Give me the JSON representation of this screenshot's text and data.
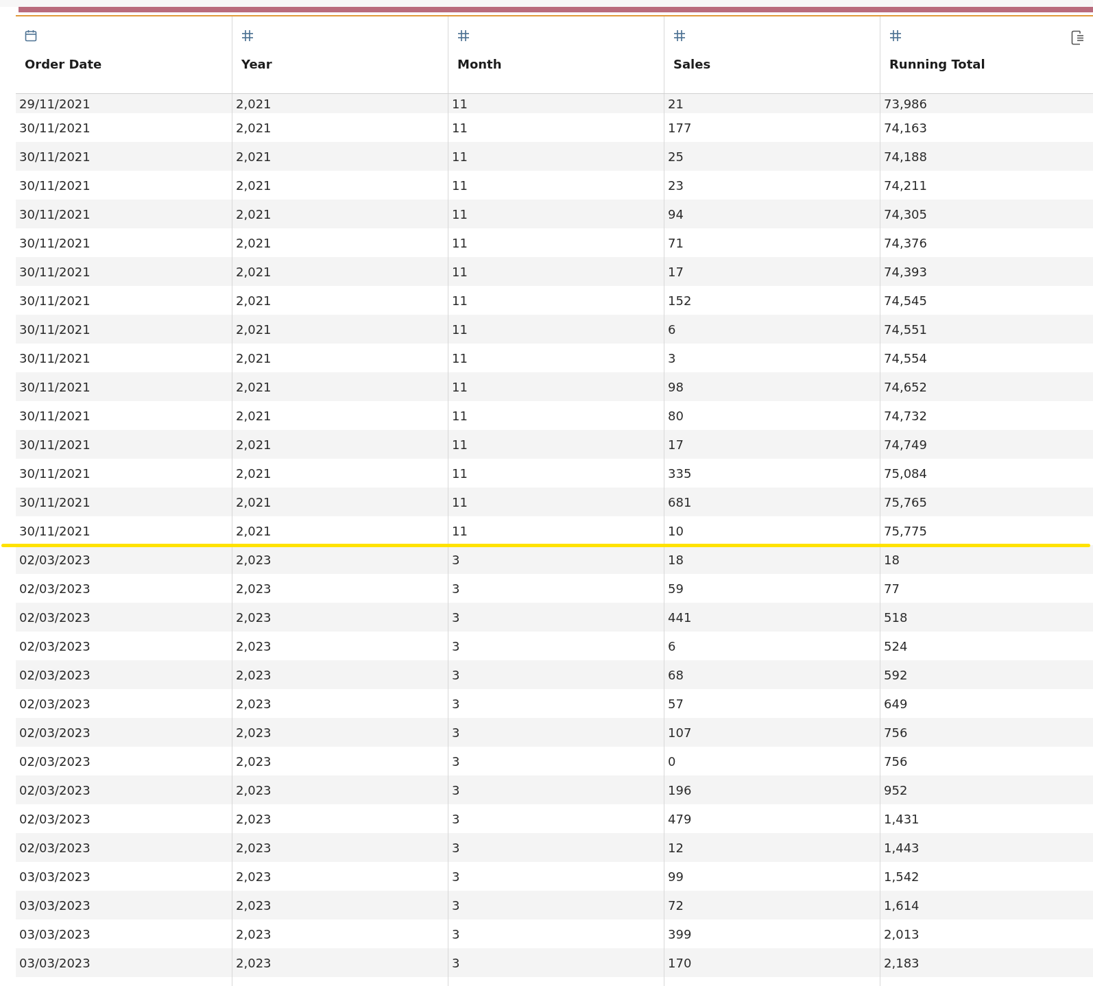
{
  "columns": [
    {
      "label": "Order Date",
      "kind": "date"
    },
    {
      "label": "Year",
      "kind": "number"
    },
    {
      "label": "Month",
      "kind": "number"
    },
    {
      "label": "Sales",
      "kind": "number"
    },
    {
      "label": "Running Total",
      "kind": "number"
    }
  ],
  "rows": [
    {
      "cells": [
        "29/11/2021",
        "2,021",
        "11",
        "21",
        "73,986"
      ],
      "marker_line_below": false
    },
    {
      "cells": [
        "30/11/2021",
        "2,021",
        "11",
        "177",
        "74,163"
      ],
      "marker_line_below": false
    },
    {
      "cells": [
        "30/11/2021",
        "2,021",
        "11",
        "25",
        "74,188"
      ],
      "marker_line_below": false
    },
    {
      "cells": [
        "30/11/2021",
        "2,021",
        "11",
        "23",
        "74,211"
      ],
      "marker_line_below": false
    },
    {
      "cells": [
        "30/11/2021",
        "2,021",
        "11",
        "94",
        "74,305"
      ],
      "marker_line_below": false
    },
    {
      "cells": [
        "30/11/2021",
        "2,021",
        "11",
        "71",
        "74,376"
      ],
      "marker_line_below": false
    },
    {
      "cells": [
        "30/11/2021",
        "2,021",
        "11",
        "17",
        "74,393"
      ],
      "marker_line_below": false
    },
    {
      "cells": [
        "30/11/2021",
        "2,021",
        "11",
        "152",
        "74,545"
      ],
      "marker_line_below": false
    },
    {
      "cells": [
        "30/11/2021",
        "2,021",
        "11",
        "6",
        "74,551"
      ],
      "marker_line_below": false
    },
    {
      "cells": [
        "30/11/2021",
        "2,021",
        "11",
        "3",
        "74,554"
      ],
      "marker_line_below": false
    },
    {
      "cells": [
        "30/11/2021",
        "2,021",
        "11",
        "98",
        "74,652"
      ],
      "marker_line_below": false
    },
    {
      "cells": [
        "30/11/2021",
        "2,021",
        "11",
        "80",
        "74,732"
      ],
      "marker_line_below": false
    },
    {
      "cells": [
        "30/11/2021",
        "2,021",
        "11",
        "17",
        "74,749"
      ],
      "marker_line_below": false
    },
    {
      "cells": [
        "30/11/2021",
        "2,021",
        "11",
        "335",
        "75,084"
      ],
      "marker_line_below": false
    },
    {
      "cells": [
        "30/11/2021",
        "2,021",
        "11",
        "681",
        "75,765"
      ],
      "marker_line_below": false
    },
    {
      "cells": [
        "30/11/2021",
        "2,021",
        "11",
        "10",
        "75,775"
      ],
      "marker_line_below": true
    },
    {
      "cells": [
        "02/03/2023",
        "2,023",
        "3",
        "18",
        "18"
      ],
      "marker_line_below": false
    },
    {
      "cells": [
        "02/03/2023",
        "2,023",
        "3",
        "59",
        "77"
      ],
      "marker_line_below": false
    },
    {
      "cells": [
        "02/03/2023",
        "2,023",
        "3",
        "441",
        "518"
      ],
      "marker_line_below": false
    },
    {
      "cells": [
        "02/03/2023",
        "2,023",
        "3",
        "6",
        "524"
      ],
      "marker_line_below": false
    },
    {
      "cells": [
        "02/03/2023",
        "2,023",
        "3",
        "68",
        "592"
      ],
      "marker_line_below": false
    },
    {
      "cells": [
        "02/03/2023",
        "2,023",
        "3",
        "57",
        "649"
      ],
      "marker_line_below": false
    },
    {
      "cells": [
        "02/03/2023",
        "2,023",
        "3",
        "107",
        "756"
      ],
      "marker_line_below": false
    },
    {
      "cells": [
        "02/03/2023",
        "2,023",
        "3",
        "0",
        "756"
      ],
      "marker_line_below": false
    },
    {
      "cells": [
        "02/03/2023",
        "2,023",
        "3",
        "196",
        "952"
      ],
      "marker_line_below": false
    },
    {
      "cells": [
        "02/03/2023",
        "2,023",
        "3",
        "479",
        "1,431"
      ],
      "marker_line_below": false
    },
    {
      "cells": [
        "02/03/2023",
        "2,023",
        "3",
        "12",
        "1,443"
      ],
      "marker_line_below": false
    },
    {
      "cells": [
        "03/03/2023",
        "2,023",
        "3",
        "99",
        "1,542"
      ],
      "marker_line_below": false
    },
    {
      "cells": [
        "03/03/2023",
        "2,023",
        "3",
        "72",
        "1,614"
      ],
      "marker_line_below": false
    },
    {
      "cells": [
        "03/03/2023",
        "2,023",
        "3",
        "399",
        "2,013"
      ],
      "marker_line_below": false
    },
    {
      "cells": [
        "03/03/2023",
        "2,023",
        "3",
        "170",
        "2,183"
      ],
      "marker_line_below": false
    }
  ]
}
